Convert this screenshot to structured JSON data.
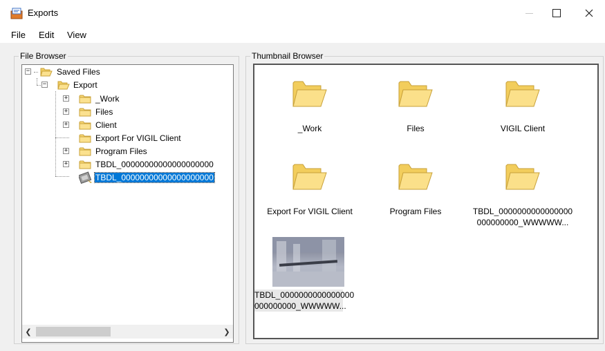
{
  "window": {
    "title": "Exports"
  },
  "menu": {
    "file": "File",
    "edit": "Edit",
    "view": "View"
  },
  "file_browser": {
    "legend": "File Browser",
    "tree": [
      {
        "label": "Saved Files",
        "level": 0,
        "expander": "−",
        "icon": "folder-open-icon"
      },
      {
        "label": "Export",
        "level": 1,
        "expander": "−",
        "icon": "folder-open-icon"
      },
      {
        "label": "_Work",
        "level": 2,
        "expander": "+",
        "icon": "folder-icon"
      },
      {
        "label": "Files",
        "level": 2,
        "expander": "+",
        "icon": "folder-icon"
      },
      {
        "label": "Client",
        "level": 2,
        "expander": "+",
        "icon": "folder-icon"
      },
      {
        "label": "Export For VIGIL Client",
        "level": 2,
        "expander": "",
        "icon": "folder-icon"
      },
      {
        "label": "Program Files",
        "level": 2,
        "expander": "+",
        "icon": "folder-icon"
      },
      {
        "label": "TBDL_00000000000000000000",
        "level": 2,
        "expander": "+",
        "icon": "folder-icon"
      },
      {
        "label": "TBDL_00000000000000000000",
        "level": 2,
        "expander": "",
        "icon": "video-file-icon",
        "selected": true
      }
    ]
  },
  "thumbnail_browser": {
    "legend": "Thumbnail Browser",
    "items": [
      {
        "label": "_Work",
        "icon": "folder-icon"
      },
      {
        "label": "Files",
        "icon": "folder-icon"
      },
      {
        "label": "VIGIL Client",
        "icon": "folder-icon"
      },
      {
        "label": "Export For VIGIL Client",
        "icon": "folder-icon"
      },
      {
        "label": "Program Files",
        "icon": "folder-icon"
      },
      {
        "label_line1": "TBDL_0000000000000000",
        "label_line2": "000000000_WWWWW...",
        "icon": "folder-icon"
      },
      {
        "label_line1": "TBDL_0000000000000000",
        "label_line2": "000000000_WWWWW...",
        "icon": "video-thumbnail"
      }
    ]
  },
  "colors": {
    "selection": "#0078d7",
    "folder": "#f7d774"
  }
}
